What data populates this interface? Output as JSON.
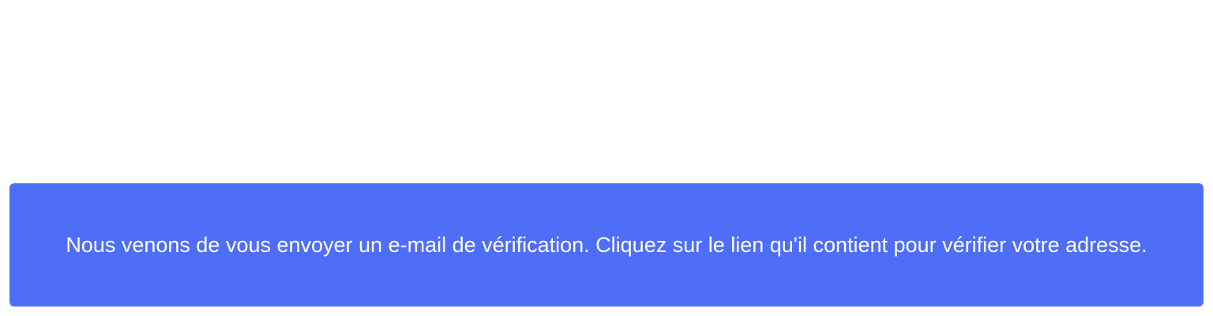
{
  "notification": {
    "message": "Nous venons de vous envoyer un e-mail de vérification. Cliquez sur le lien qu'il contient pour vérifier votre adresse.",
    "background_color": "#4f6ef7",
    "text_color": "#ffffff"
  }
}
